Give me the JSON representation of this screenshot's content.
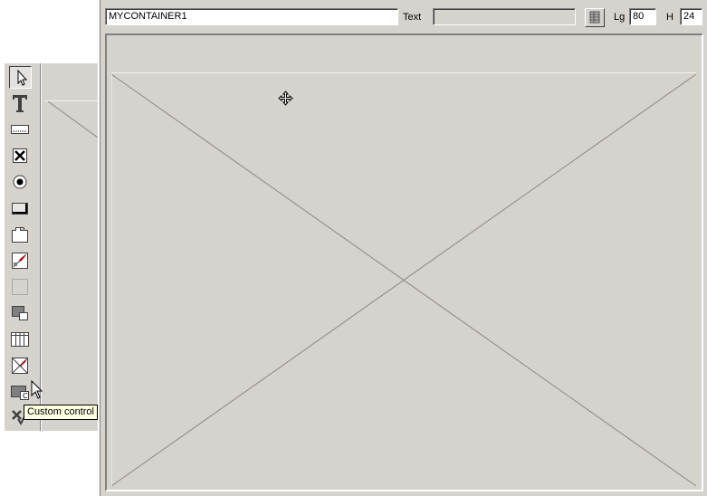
{
  "properties_bar": {
    "name_value": "MYCONTAINER1",
    "text_label": "Text",
    "text_value": "",
    "width_label": "Lg",
    "width_value": "80",
    "height_label": "H",
    "height_value": "24"
  },
  "toolbar": {
    "tools": [
      {
        "name": "pointer-tool",
        "icon": "arrow-pointer-icon"
      },
      {
        "name": "static-text-tool",
        "icon": "text-t-icon"
      },
      {
        "name": "edit-field-tool",
        "icon": "edit-field-icon"
      },
      {
        "name": "checkbox-tool",
        "icon": "checkbox-icon"
      },
      {
        "name": "radio-button-tool",
        "icon": "radio-button-icon"
      },
      {
        "name": "button-tool",
        "icon": "push-button-icon"
      },
      {
        "name": "tab-tool",
        "icon": "tab-control-icon"
      },
      {
        "name": "image-tool",
        "icon": "image-icon"
      },
      {
        "name": "cell-tool",
        "icon": "cell-icon"
      },
      {
        "name": "container-tool",
        "icon": "container-icon"
      },
      {
        "name": "table-tool",
        "icon": "table-icon"
      },
      {
        "name": "activex-tool",
        "icon": "activex-icon"
      },
      {
        "name": "custom-control-tool",
        "icon": "custom-control-icon"
      },
      {
        "name": "extra-control-tool",
        "icon": "extra-control-icon"
      }
    ],
    "tooltip": "Custom control"
  }
}
